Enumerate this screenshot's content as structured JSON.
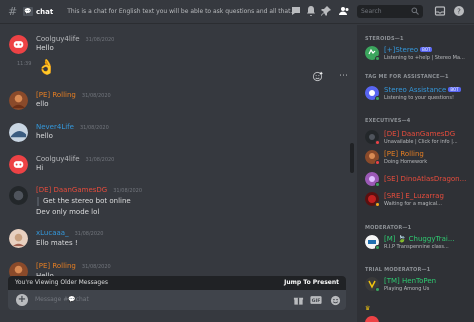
{
  "header": {
    "channel_name": "chat",
    "channel_emoji": "💬",
    "topic": "This is a chat for English text you will be able to ask questions and all that. Off-...",
    "search_placeholder": "Search"
  },
  "messages": [
    {
      "user": "Coolguy4life",
      "time": "31/08/2020",
      "text": "Hello",
      "color": "#b9bbbe",
      "avatar": "discord"
    },
    {
      "side_time": "11:39",
      "sticker": "👌"
    },
    {
      "user": "[PE] Rolling",
      "time": "31/08/2020",
      "text": "ello",
      "color": "#e67e22",
      "avatar": "orange"
    },
    {
      "user": "Never4Life",
      "time": "31/08/2020",
      "text": "hello",
      "color": "#3498db",
      "avatar": "blue"
    },
    {
      "user": "Coolguy4life",
      "time": "31/08/2020",
      "text": "Hi",
      "color": "#b9bbbe",
      "avatar": "discord"
    },
    {
      "user": "[DE] DaanGamesDG",
      "time": "31/08/2020",
      "text": "Get the stereo bot online",
      "text2": "Dev only mode lol",
      "color": "#e74c3c",
      "avatar": "dark"
    },
    {
      "user": "xLucaaa_",
      "time": "31/08/2020",
      "text": "Ello mates !",
      "color": "#3498db",
      "avatar": "pink"
    },
    {
      "user": "[PE] Rolling",
      "time": "31/08/2020",
      "text": "Hello",
      "color": "#e67e22",
      "avatar": "orange"
    }
  ],
  "jump": {
    "notice": "You're Viewing Older Messages",
    "action": "Jump To Present"
  },
  "composer": {
    "placeholder": "Message #💬chat"
  },
  "members": {
    "roles": [
      {
        "label": "STEROIDS—1"
      },
      {
        "label": "TAG ME FOR ASSISTANCE—1"
      },
      {
        "label": "EXECUTIVES—4"
      },
      {
        "label": "MODERATOR—1"
      },
      {
        "label": "TRIAL MODERATOR—1"
      }
    ],
    "list": [
      {
        "name": "[+]Stereo",
        "sub": "Listening to +help | Stereo Ma...",
        "color": "#3498db",
        "bot": "BOT",
        "status": "#3ba55d"
      },
      {
        "name": "Stereo Assistance",
        "sub": "Listening to your questions!",
        "color": "#3498db",
        "bot": "BOT",
        "status": "#3ba55d"
      },
      {
        "name": "[DE] DaanGamesDG",
        "sub": "Unavailable | Click for info |...",
        "color": "#e74c3c",
        "status": "#ed4245"
      },
      {
        "name": "[PE] Rolling",
        "sub": "Doing Homework",
        "color": "#e67e22",
        "status": "#ed4245"
      },
      {
        "name": "[SE] DinoAtlasDragon...",
        "sub": "",
        "color": "#e74c3c",
        "status": "#3ba55d"
      },
      {
        "name": "[SRE] E_Luzarrag",
        "sub": "Waiting for a magical...",
        "color": "#e74c3c",
        "status": "#faa61a"
      },
      {
        "name": "[M] 🍃 ChuggyTrai...",
        "sub": "R.I.P Transpennine class...",
        "color": "#2ecc71",
        "status": "#3ba55d"
      },
      {
        "name": "[TM] HenToPen",
        "sub": "Playing Among Us",
        "color": "#2ecc71",
        "status": "#3ba55d"
      }
    ]
  }
}
